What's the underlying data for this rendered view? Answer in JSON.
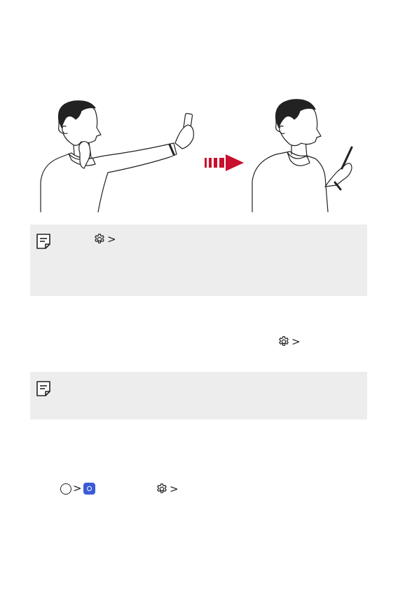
{
  "illustration": {
    "person_left": "person-holding-phone-up",
    "arrow": "arrow-right-icon",
    "person_right": "person-lowering-phone",
    "arrow_color": "#c8102e"
  },
  "notes": [
    {
      "icon": "note-icon"
    },
    {
      "icon": "note-icon"
    }
  ],
  "icons": {
    "gear": "gear-icon",
    "chevron": ">",
    "home": "home-circle-icon",
    "camera": "camera-app-icon"
  }
}
